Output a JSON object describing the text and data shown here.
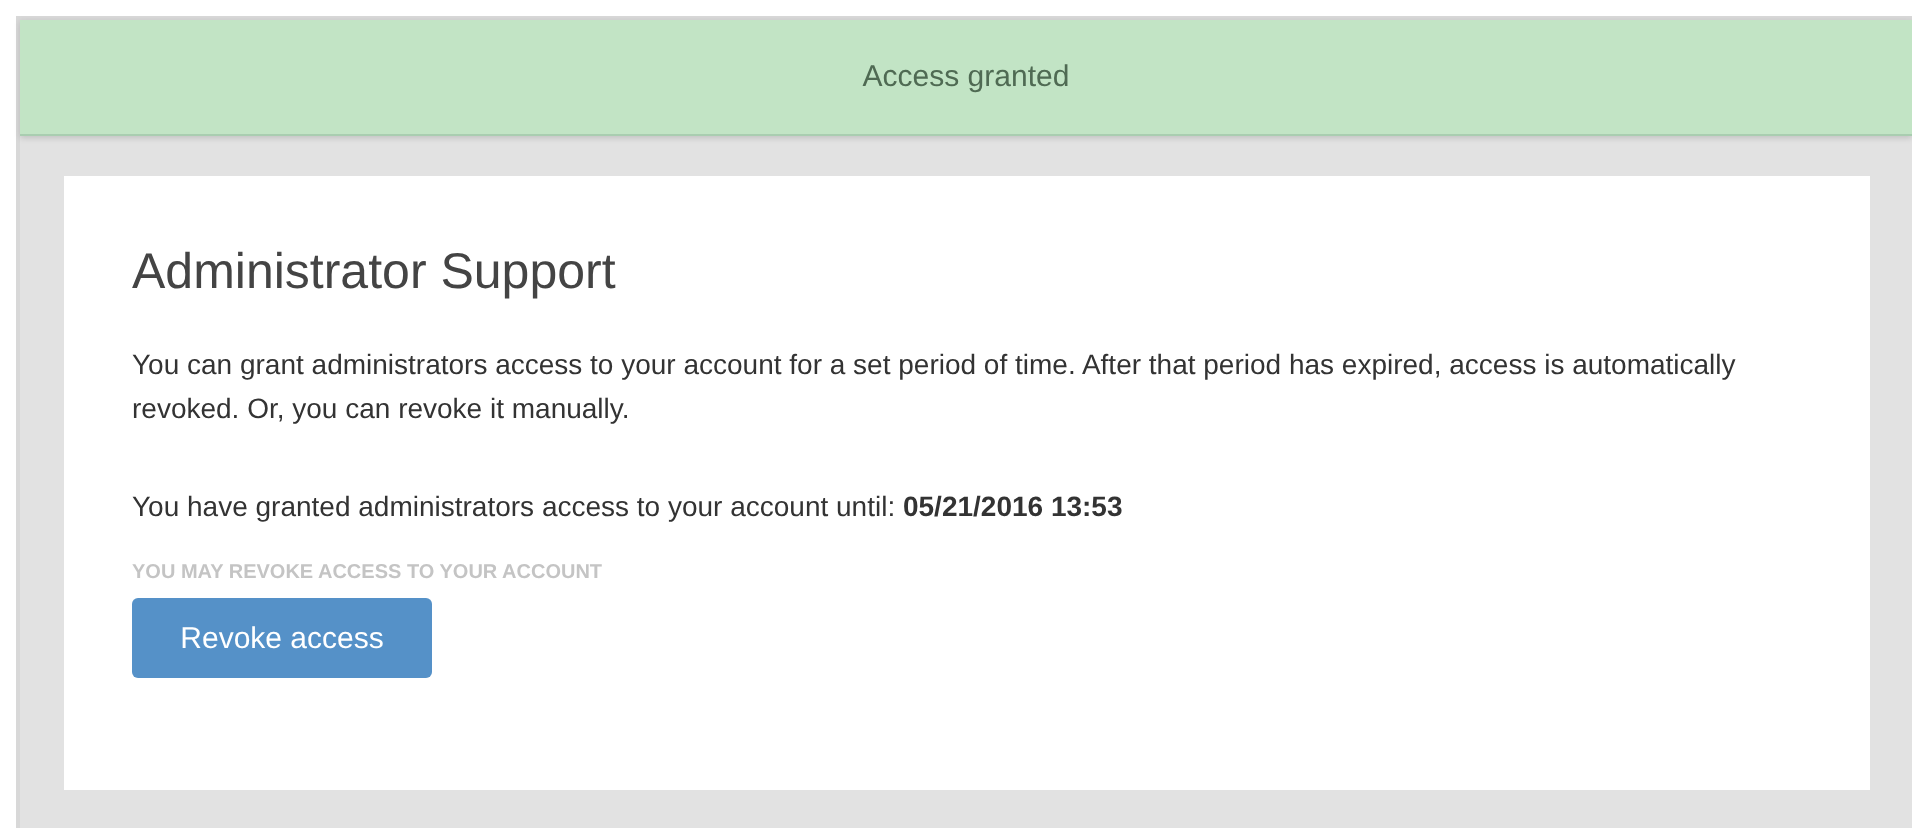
{
  "banner": {
    "text": "Access granted"
  },
  "card": {
    "title": "Administrator Support",
    "description": "You can grant administrators access to your account for a set period of time. After that period has expired, access is automatically revoked. Or, you can revoke it manually.",
    "status": "You have granted administrators access to your account until: **05/21/2016 13:53**",
    "caption": "YOU MAY REVOKE ACCESS TO YOUR ACCOUNT",
    "button": "Revoke access"
  }
}
